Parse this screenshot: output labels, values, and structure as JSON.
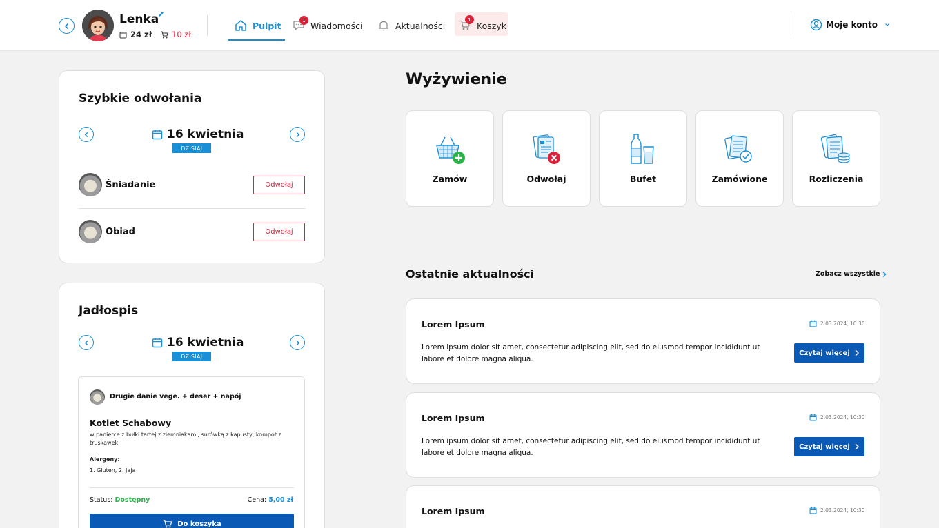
{
  "header": {
    "user_name": "Lenka",
    "wallet_balance": "24 zł",
    "cart_amount": "10 zł",
    "nav": [
      {
        "label": "Pulpit",
        "icon": "home-icon",
        "active": true
      },
      {
        "label": "Wiadomości",
        "icon": "chat-icon",
        "badge": "1"
      },
      {
        "label": "Aktualności",
        "icon": "bell-icon"
      },
      {
        "label": "Koszyk",
        "icon": "cart-icon",
        "badge": "1"
      }
    ],
    "account_label": "Moje konto"
  },
  "quick_cancel": {
    "title": "Szybkie odwołania",
    "date": "16 kwietnia",
    "today": "DZISIAJ",
    "meals": [
      {
        "label": "Śniadanie",
        "action": "Odwołaj"
      },
      {
        "label": "Obiad",
        "action": "Odwołaj"
      }
    ]
  },
  "menu": {
    "title": "Jadłospis",
    "date": "16 kwietnia",
    "today": "DZISIAJ",
    "item": {
      "category": "Drugie danie vege. + deser + napój",
      "name": "Kotlet Schabowy",
      "description": "w panierce z bułki tartej z ziemniakami, surówką z kapusty, kompot z truskawek",
      "allergens_label": "Alergeny:",
      "allergens": "1. Gluten, 2. Jaja",
      "status_label": "Status:",
      "status_value": "Dostępny",
      "price_label": "Cena:",
      "price_value": "5,00 zł",
      "add_to_cart": "Do koszyka"
    }
  },
  "nutrition": {
    "title": "Wyżywienie",
    "tiles": [
      {
        "label": "Zamów",
        "icon": "basket-add-icon"
      },
      {
        "label": "Odwołaj",
        "icon": "document-cancel-icon"
      },
      {
        "label": "Bufet",
        "icon": "bottle-glass-icon"
      },
      {
        "label": "Zamówione",
        "icon": "document-check-icon"
      },
      {
        "label": "Rozliczenia",
        "icon": "documents-coins-icon"
      }
    ]
  },
  "news": {
    "title": "Ostatnie aktualności",
    "see_all": "Zobacz wszystkie",
    "items": [
      {
        "title": "Lorem Ipsum",
        "date": "2.03.2024, 10:30",
        "text": "Lorem ipsum dolor sit amet, consectetur adipiscing elit, sed do eiusmod tempor incididunt ut labore et dolore magna aliqua.",
        "button": "Czytaj więcej"
      },
      {
        "title": "Lorem Ipsum",
        "date": "2.03.2024, 10:30",
        "text": "Lorem ipsum dolor sit amet, consectetur adipiscing elit, sed do eiusmod tempor incididunt ut labore et dolore magna aliqua.",
        "button": "Czytaj więcej"
      },
      {
        "title": "Lorem Ipsum",
        "date": "2.03.2024, 10:30",
        "text": "",
        "button": ""
      }
    ]
  },
  "colors": {
    "accent": "#1a8fd6",
    "primary_button": "#0a59b5",
    "danger": "#d8233a",
    "success": "#2bb34a"
  }
}
